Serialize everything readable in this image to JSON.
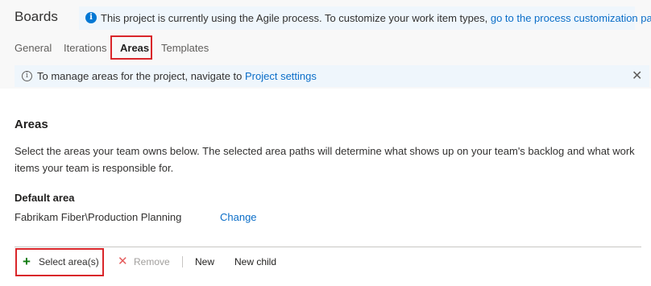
{
  "app": {
    "title": "Boards"
  },
  "banner": {
    "icon": "info-solid-icon",
    "text": "This project is currently using the Agile process. To customize your work item types, ",
    "link": "go to the process customization page."
  },
  "tabs": [
    {
      "label": "General",
      "active": false
    },
    {
      "label": "Iterations",
      "active": false
    },
    {
      "label": "Areas",
      "active": true
    },
    {
      "label": "Templates",
      "active": false
    }
  ],
  "info_bar": {
    "icon": "info-outline-icon",
    "text": "To manage areas for the project, navigate to ",
    "link": "Project settings",
    "close_icon": "close-icon"
  },
  "main": {
    "title": "Areas",
    "description": "Select the areas your team owns below. The selected area paths will determine what shows up on your team's backlog and what work items your team is responsible for.",
    "default_area_label": "Default area",
    "default_area_path": "Fabrikam Fiber\\Production Planning",
    "change_link": "Change"
  },
  "toolbar": {
    "select_areas": "Select area(s)",
    "remove": "Remove",
    "new": "New",
    "new_child": "New child"
  },
  "colors": {
    "accent": "#0078d4",
    "link": "#0b6ec8",
    "highlight": "#d9262a",
    "add_green": "#107c10",
    "remove_red": "#e55c5c"
  }
}
